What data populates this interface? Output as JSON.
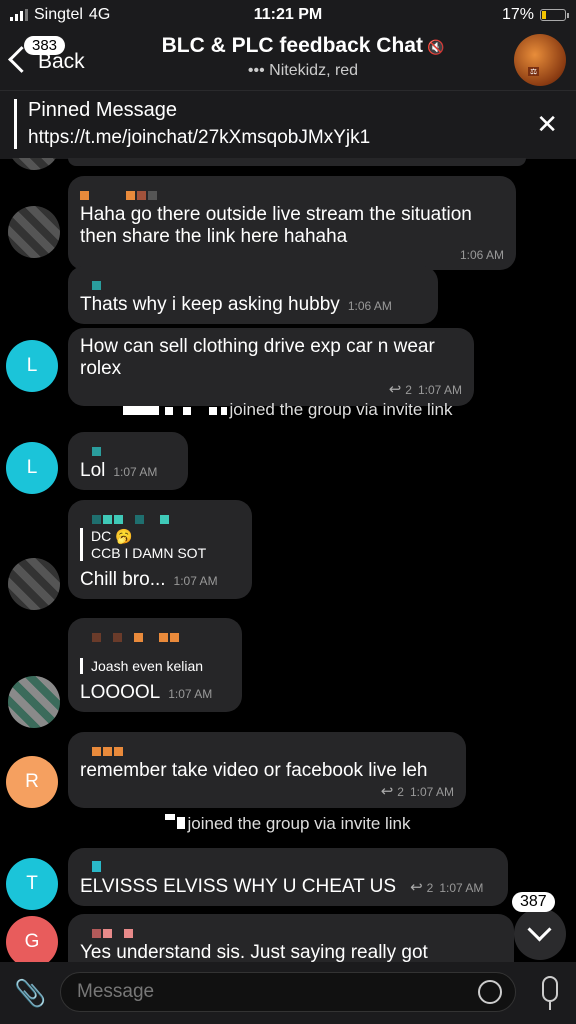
{
  "status_bar": {
    "carrier": "Singtel",
    "network": "4G",
    "time": "11:21 PM",
    "battery": "17%",
    "battery_level": 0.17
  },
  "header": {
    "back_label": "Back",
    "unread_badge": "383",
    "title": "BLC & PLC feedback Chat",
    "typing_text": "••• Nitekidz, red"
  },
  "pinned": {
    "label": "Pinned Message",
    "text": "https://t.me/joinchat/27kXmsqobJMxYjk1"
  },
  "messages": [
    {
      "text": "Haha go there outside live stream the situation then share the link here hahaha",
      "time": "1:06 AM"
    },
    {
      "text": "Thats why i keep asking hubby",
      "time": "1:06 AM"
    },
    {
      "avatar": "L",
      "text": "How can sell clothing drive exp car n wear rolex",
      "replies": "2",
      "time": "1:07 AM"
    },
    {
      "system": "joined the group via invite link"
    },
    {
      "avatar": "L",
      "text": "Lol",
      "time": "1:07 AM"
    },
    {
      "quote_name": "DC 🥱",
      "quote_text": "CCB I DAMN SOT",
      "text": "Chill bro...",
      "time": "1:07 AM"
    },
    {
      "quote_text": "Joash even kelian",
      "text": "LOOOOL",
      "time": "1:07 AM"
    },
    {
      "avatar": "R",
      "text": "remember take video or facebook live leh",
      "replies": "2",
      "time": "1:07 AM"
    },
    {
      "system": "joined the group via invite link"
    },
    {
      "avatar": "T",
      "text": "ELVISSS ELVISS WHY U CHEAT US",
      "replies": "2",
      "time": "1:07 AM"
    },
    {
      "avatar": "G",
      "text": "Yes understand sis. Just saying really got"
    }
  ],
  "scroll_badge": "387",
  "composer": {
    "placeholder": "Message"
  },
  "colors": {
    "avatar_L": "#1bc4d9",
    "avatar_R": "#f5a060",
    "avatar_T": "#1bc4d9",
    "avatar_G": "#e85c5c",
    "bubble": "#262628",
    "bar": "#1b1b1d"
  }
}
